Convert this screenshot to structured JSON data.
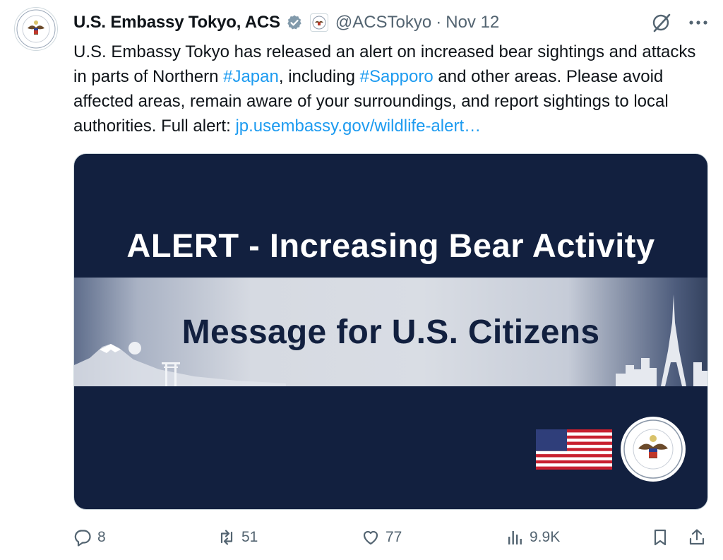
{
  "author": {
    "display_name": "U.S. Embassy Tokyo, ACS",
    "handle": "@ACSTokyo",
    "date": "Nov 12",
    "separator": "·",
    "verified": true,
    "avatar_icon": "embassy-seal-icon"
  },
  "tweet": {
    "text_before_tag1": "U.S. Embassy Tokyo has released an alert on increased bear sightings and attacks in parts of Northern ",
    "hashtag1": "#Japan",
    "text_between": ", including ",
    "hashtag2": "#Sapporo",
    "text_after": " and other areas. Please avoid affected areas, remain aware of your surroundings, and report sightings to local authorities. Full alert: ",
    "link": "jp.usembassy.gov/wildlife-alert…"
  },
  "media": {
    "headline": "ALERT - Increasing Bear Activity",
    "banner_title": "Message for U.S. Citizens",
    "background_color": "#12203f"
  },
  "actions": {
    "replies": "8",
    "reposts": "51",
    "likes": "77",
    "views": "9.9K"
  },
  "colors": {
    "link": "#1d9bf0",
    "secondary_text": "#536471",
    "verified_badge": "#829aab"
  }
}
